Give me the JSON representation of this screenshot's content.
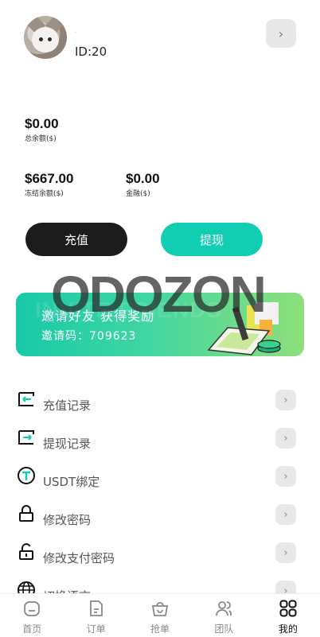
{
  "profile": {
    "name": "·",
    "id_text": "ID:20",
    "arrow": "›"
  },
  "balances": {
    "total": {
      "amount": "$0.00",
      "label": "总余额($)"
    },
    "frozen": {
      "amount": "$667.00",
      "label": "冻结余额($)"
    },
    "gold": {
      "amount": "$0.00",
      "label": "金融($)"
    }
  },
  "actions": {
    "recharge": "充值",
    "withdraw": "提现"
  },
  "banner": {
    "title": "邀请好友 获得奖励",
    "code": "邀请码：709623",
    "bg_text": "INVITE FRIENDS"
  },
  "watermark": "ODOZON",
  "menu": {
    "items": [
      {
        "label": "充值记录",
        "icon": "recharge-record-icon"
      },
      {
        "label": "提现记录",
        "icon": "withdraw-record-icon"
      },
      {
        "label": "USDT绑定",
        "icon": "usdt-icon"
      },
      {
        "label": "修改密码",
        "icon": "lock-icon"
      },
      {
        "label": "修改支付密码",
        "icon": "unlock-icon"
      },
      {
        "label": "切换语言",
        "icon": "globe-icon"
      }
    ],
    "arrow": "›"
  },
  "tabbar": {
    "items": [
      {
        "label": "首页",
        "icon": "home-icon"
      },
      {
        "label": "订单",
        "icon": "order-icon"
      },
      {
        "label": "抢单",
        "icon": "bag-icon"
      },
      {
        "label": "团队",
        "icon": "team-icon"
      },
      {
        "label": "我的",
        "icon": "grid-icon",
        "active": true
      }
    ]
  },
  "colors": {
    "accent": "#11cdb2",
    "dark_button": "#1c1c1c",
    "banner_start": "#18c9a7",
    "banner_end": "#8ee07a"
  }
}
